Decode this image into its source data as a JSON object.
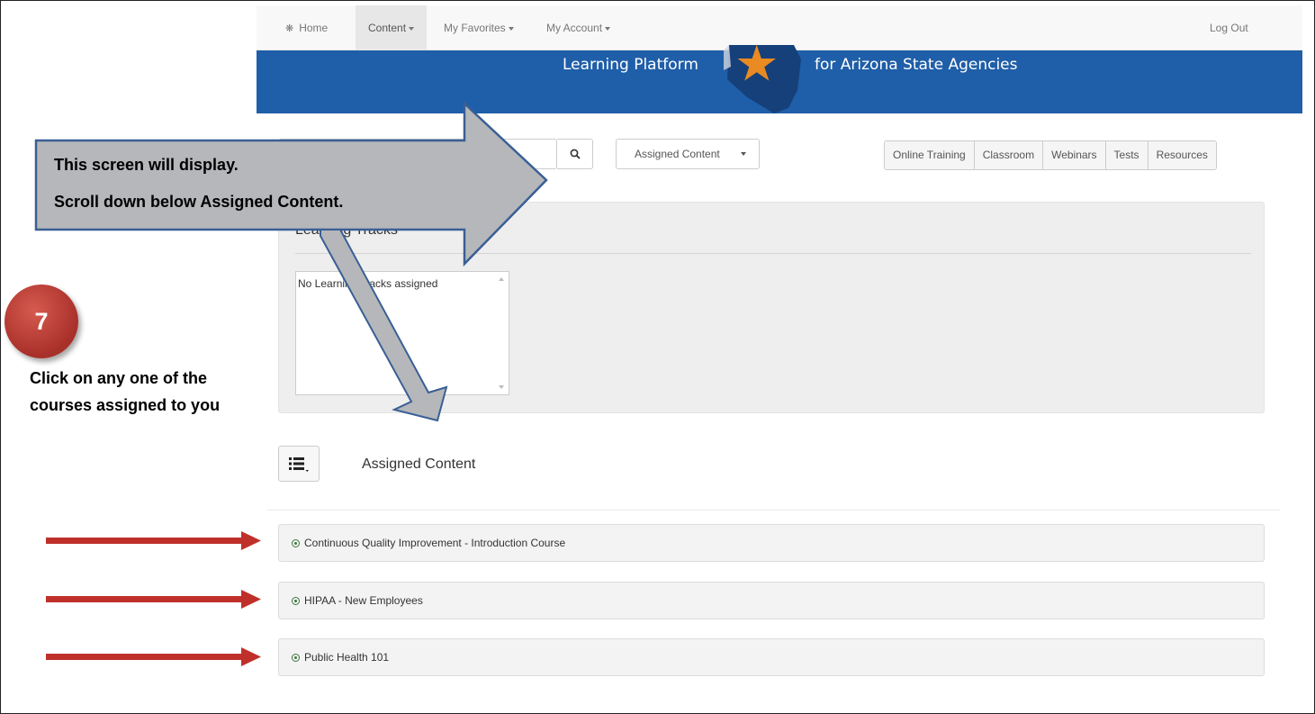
{
  "navbar": {
    "home": "Home",
    "content": "Content",
    "favorites": "My Favorites",
    "account": "My Account",
    "logout": "Log Out",
    "home_icon": "home-icon"
  },
  "banner": {
    "left_text": "Learning Platform",
    "right_text": "for Arizona State Agencies"
  },
  "toolbar": {
    "search_placeholder": "",
    "select_value": "Assigned Content",
    "filters": [
      "Online Training",
      "Classroom",
      "Webinars",
      "Tests",
      "Resources"
    ]
  },
  "tracks": {
    "title": "Learning Tracks",
    "empty": "No Learning Tracks assigned"
  },
  "assigned": {
    "title": "Assigned Content",
    "courses": [
      "Continuous Quality Improvement - Introduction Course",
      "HIPAA - New Employees",
      "Public Health 101"
    ]
  },
  "annotations": {
    "callout_line1": "This screen will display.",
    "callout_line2": "Scroll down below Assigned Content.",
    "step_number": "7",
    "instruction_line1": "Click on any one of the",
    "instruction_line2": "courses assigned to you"
  },
  "colors": {
    "banner": "#1f5ea8",
    "callout": "#b5b7ba",
    "arrow_outline": "#3a5f94",
    "red_arrow": "#c0302a",
    "badge": "#b33a32",
    "status_dot": "#3c763d"
  }
}
